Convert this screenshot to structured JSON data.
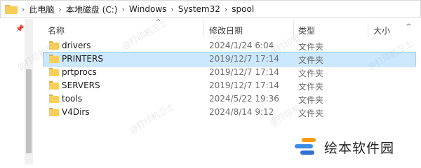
{
  "address_bar": {
    "crumbs": [
      "此电脑",
      "本地磁盘 (C:)",
      "Windows",
      "System32",
      "spool"
    ]
  },
  "columns": {
    "name": "名称",
    "date_modified": "修改日期",
    "type": "类型",
    "size": "大小"
  },
  "rows": [
    {
      "name": "drivers",
      "date": "2024/1/24 6:04",
      "type": "文件夹",
      "selected": false
    },
    {
      "name": "PRINTERS",
      "date": "2019/12/7 17:14",
      "type": "文件夹",
      "selected": true
    },
    {
      "name": "prtprocs",
      "date": "2019/12/7 17:14",
      "type": "文件夹",
      "selected": false
    },
    {
      "name": "SERVERS",
      "date": "2019/12/7 17:14",
      "type": "文件夹",
      "selected": false
    },
    {
      "name": "tools",
      "date": "2024/5/22 19:36",
      "type": "文件夹",
      "selected": false
    },
    {
      "name": "V4Dirs",
      "date": "2024/8/14 9:12",
      "type": "文件夹",
      "selected": false
    }
  ],
  "watermark": "@打印机卫士",
  "logo_text": "绘本软件园",
  "colors": {
    "selection": "#cce8ff",
    "folder": "#f8cf5b",
    "logo_orange": "#f39c12",
    "logo_blue": "#3a8ee6"
  }
}
